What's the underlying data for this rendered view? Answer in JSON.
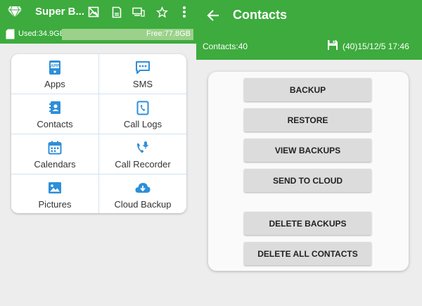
{
  "left_panel": {
    "app_title": "Super B...",
    "toolbar_icons": [
      "image-off-icon",
      "sd-card-icon",
      "devices-icon",
      "star-icon",
      "more-vert-icon"
    ],
    "storage": {
      "used_label": "Used:34.9GB",
      "free_label": "Free:77.8GB"
    },
    "grid_items": [
      {
        "label": "Apps",
        "icon": "apps-icon"
      },
      {
        "label": "SMS",
        "icon": "sms-icon"
      },
      {
        "label": "Contacts",
        "icon": "contacts-icon"
      },
      {
        "label": "Call Logs",
        "icon": "call-logs-icon"
      },
      {
        "label": "Calendars",
        "icon": "calendar-icon"
      },
      {
        "label": "Call Recorder",
        "icon": "call-recorder-icon"
      },
      {
        "label": "Pictures",
        "icon": "pictures-icon"
      },
      {
        "label": "Cloud Backup",
        "icon": "cloud-backup-icon"
      }
    ]
  },
  "right_panel": {
    "title": "Contacts",
    "contacts_count": "Contacts:40",
    "last_backup": "(40)15/12/5 17:46",
    "buttons": [
      {
        "label": "BACKUP"
      },
      {
        "label": "RESTORE"
      },
      {
        "label": "VIEW BACKUPS"
      },
      {
        "label": "SEND TO CLOUD"
      },
      {
        "label": "DELETE BACKUPS"
      },
      {
        "label": "DELETE ALL CONTACTS"
      }
    ]
  },
  "colors": {
    "brand_green": "#3dab3d",
    "icon_blue": "#2e8fd9",
    "background": "#ededed"
  }
}
